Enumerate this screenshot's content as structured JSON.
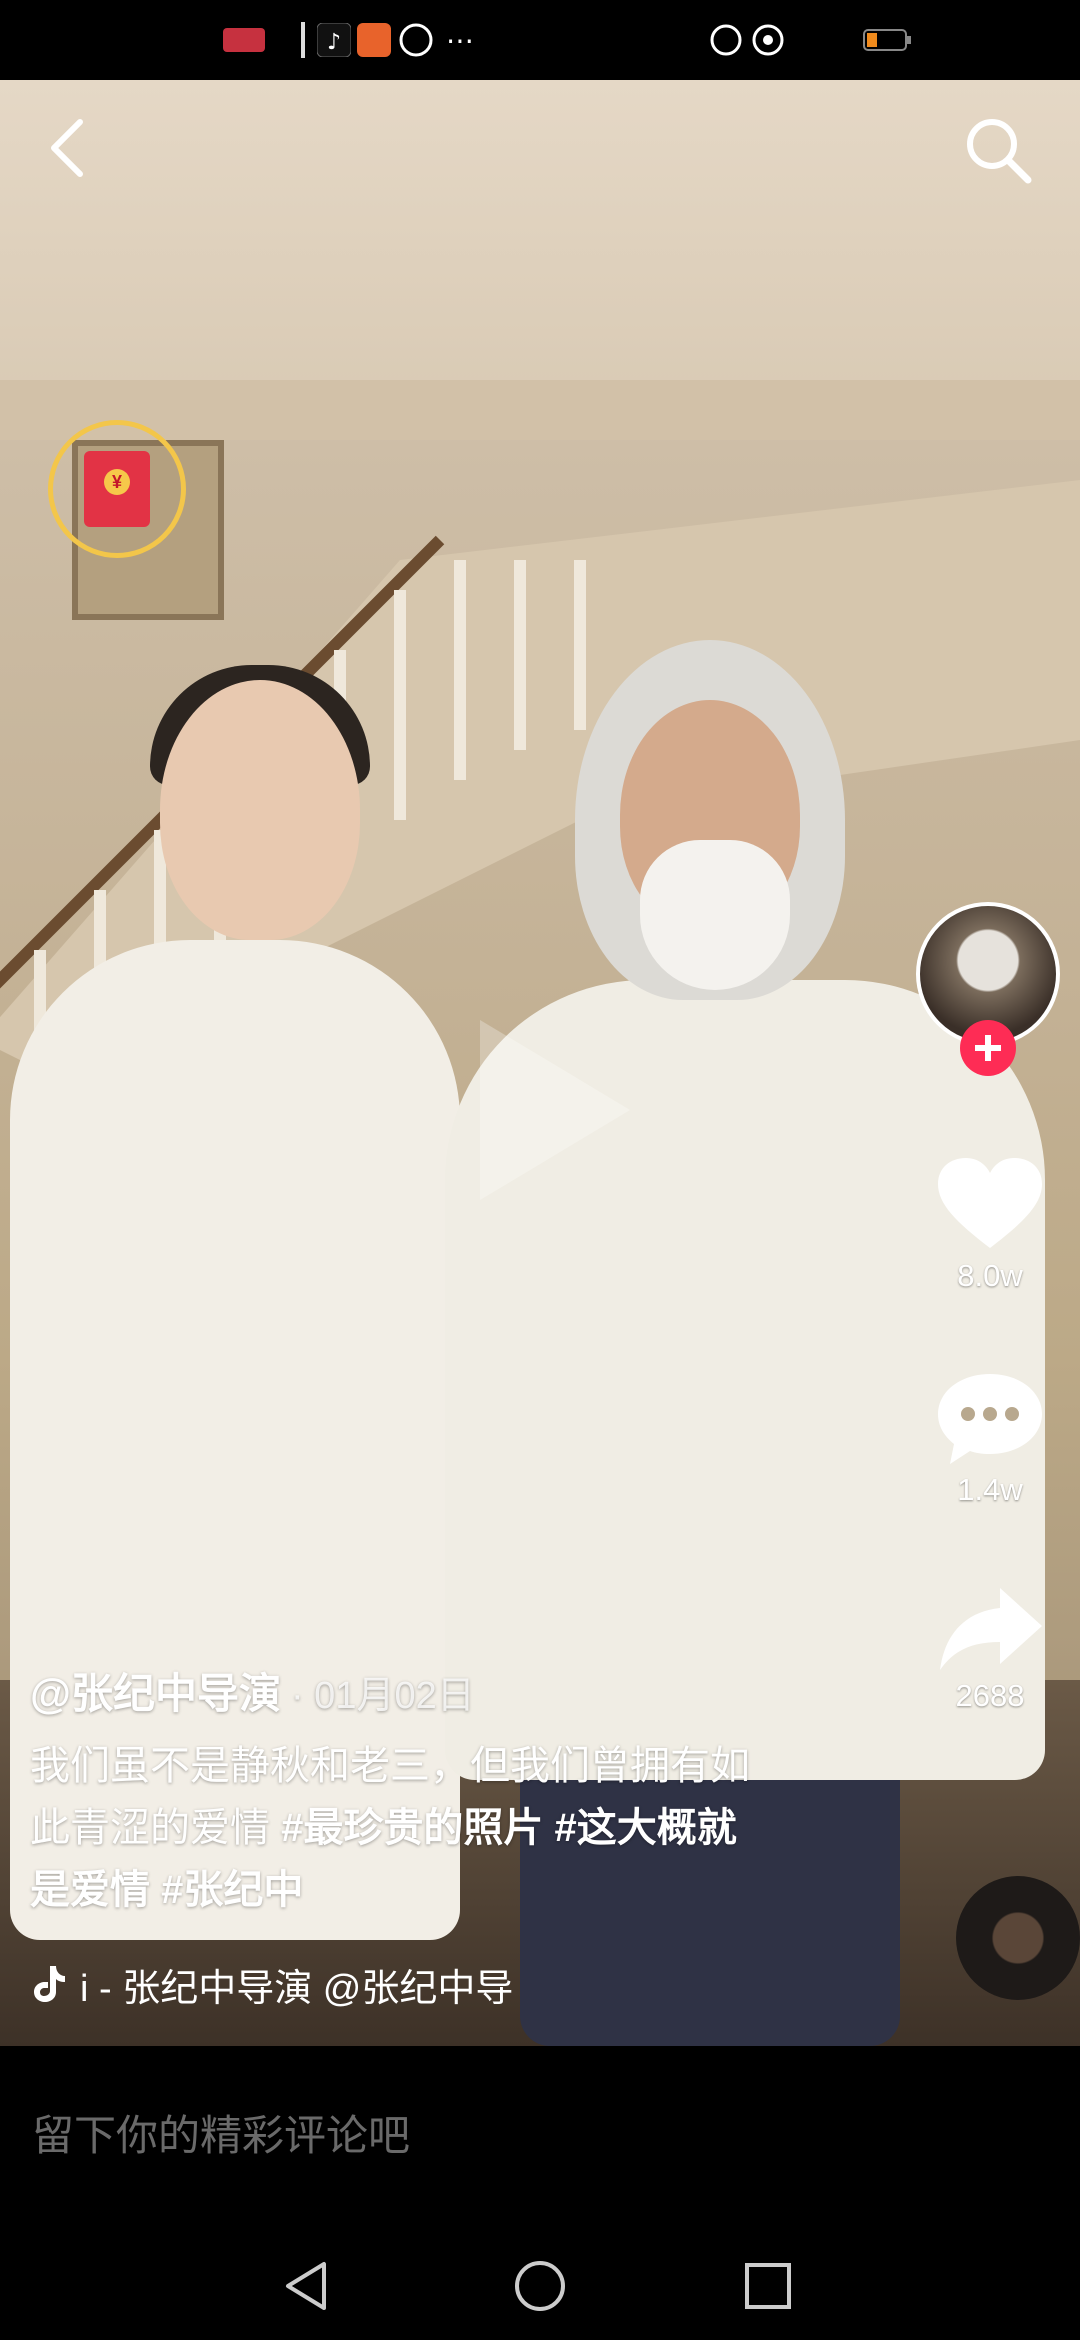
{
  "video": {
    "author": "@张纪中导演",
    "date": "· 01月02日",
    "desc_text": "我们虽不是静秋和老三，但我们曾拥有如此青涩的爱情 ",
    "tags": [
      "#最珍贵的照片 #",
      "这大概就是爱情 ",
      "#张纪中"
    ],
    "music_text": "i - 张纪中导演   @张纪中导"
  },
  "actions": {
    "like_count": "8.0w",
    "comment_count": "1.4w",
    "share_count": "2688"
  },
  "comment": {
    "placeholder": "留下你的精彩评论吧"
  },
  "colors": {
    "accent": "#fe2c55",
    "ring": "#f3c64a",
    "envelope": "#e23345"
  },
  "icons": [
    "back-icon",
    "search-icon",
    "red-packet-icon",
    "play-icon",
    "heart-icon",
    "comment-icon",
    "share-icon",
    "music-note-icon",
    "nav-back-icon",
    "nav-home-icon",
    "nav-recents-icon"
  ]
}
